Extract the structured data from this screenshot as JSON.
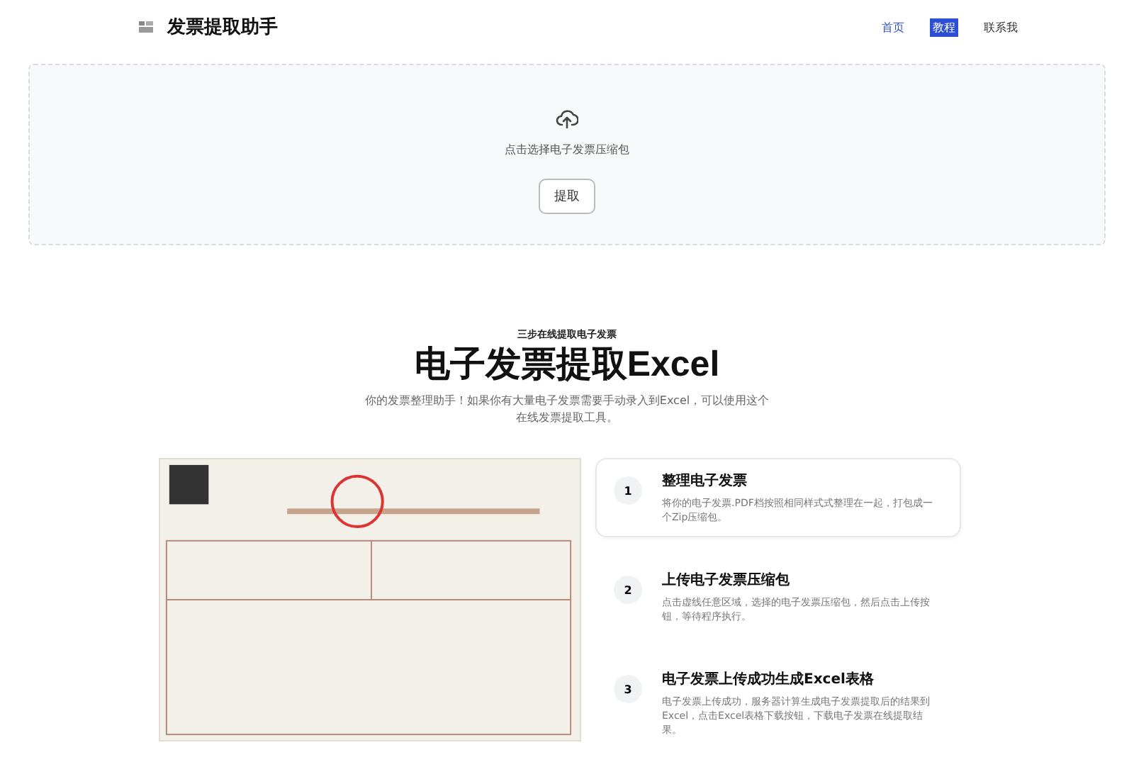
{
  "header": {
    "logo_text": "发票提取助手",
    "nav": [
      {
        "label": "首页",
        "selected": false
      },
      {
        "label": "教程",
        "selected": true
      },
      {
        "label": "联系我",
        "selected": false
      }
    ]
  },
  "upload": {
    "hint": "点击选择电子发票压缩包",
    "button": "提取"
  },
  "intro": {
    "eyebrow": "三步在线提取电子发票",
    "title": "电子发票提取Excel",
    "description": "你的发票整理助手！如果你有大量电子发票需要手动录入到Excel，可以使用这个在线发票提取工具。"
  },
  "steps": [
    {
      "number": "1",
      "title": "整理电子发票",
      "text": "将你的电子发票.PDF档按照相同样式式整理在一起，打包成一个Zip压缩包。",
      "selected": true
    },
    {
      "number": "2",
      "title": "上传电子发票压缩包",
      "text": "点击虚线任意区域，选择的电子发票压缩包，然后点击上传按钮，等待程序执行。",
      "selected": false
    },
    {
      "number": "3",
      "title": "电子发票上传成功生成Excel表格",
      "text": "电子发票上传成功，服务器计算生成电子发票提取后的结果到Excel，点击Excel表格下载按钮，下载电子发票在线提取结果。",
      "selected": false
    }
  ]
}
